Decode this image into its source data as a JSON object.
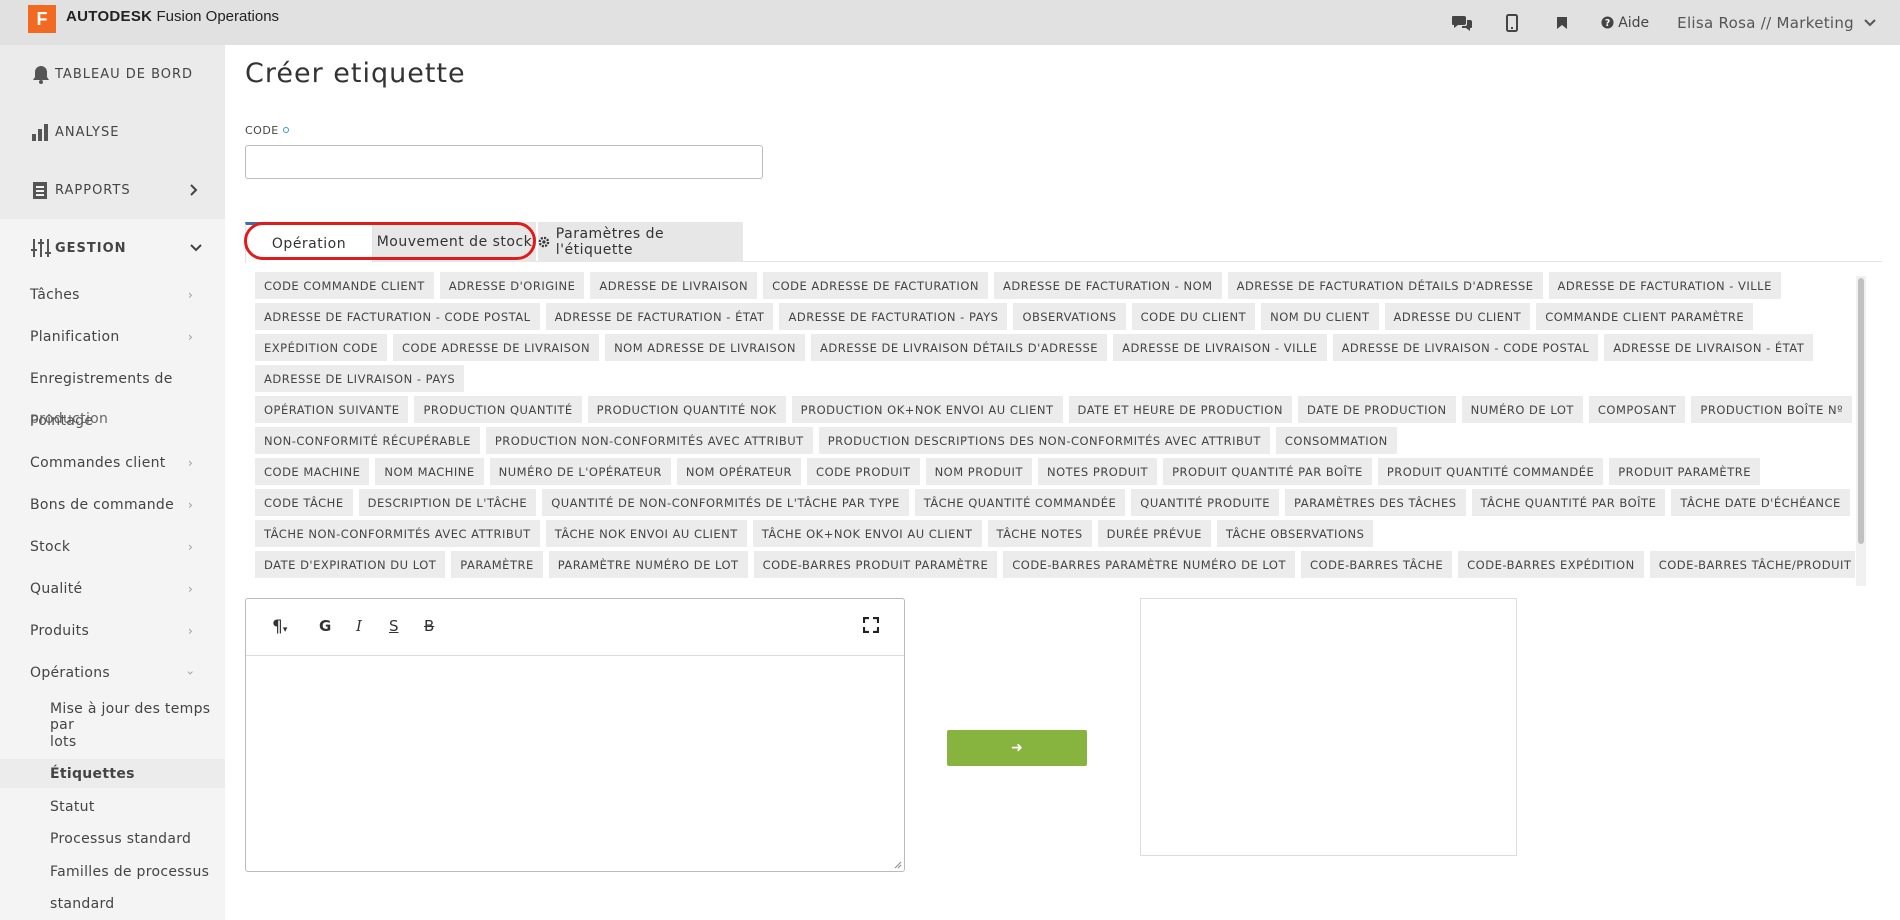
{
  "header": {
    "logo_letter": "F",
    "brand_bold": "AUTODESK",
    "brand_rest": "Fusion Operations",
    "help_label": "Aide",
    "user_label": "Elisa Rosa // Marketing"
  },
  "sidebar": {
    "main": [
      {
        "label": "TABLEAU DE BORD"
      },
      {
        "label": "ANALYSE"
      },
      {
        "label": "RAPPORTS"
      },
      {
        "label": "GESTION"
      }
    ],
    "items": [
      {
        "label": "Tâches"
      },
      {
        "label": "Planification"
      },
      {
        "label": "Enregistrements de"
      },
      {
        "label": "Commandes client"
      },
      {
        "label": "Bons de commande"
      },
      {
        "label": "Stock"
      },
      {
        "label": "Qualité"
      },
      {
        "label": "Produits"
      },
      {
        "label": "Opérations"
      }
    ],
    "overlap_line_a": "production",
    "overlap_line_b": "Pointage",
    "sub": [
      {
        "label": "Mise à jour des temps par"
      },
      {
        "label": "lots"
      },
      {
        "label": "Étiquettes"
      },
      {
        "label": "Statut"
      },
      {
        "label": "Processus standard"
      },
      {
        "label": "Familles de processus"
      },
      {
        "label": "standard"
      }
    ]
  },
  "main": {
    "title": "Créer etiquette",
    "code_label": "CODE",
    "code_value": "",
    "tabs": {
      "operation": "Opération",
      "stock": "Mouvement de stock",
      "params": "Paramètres de l'étiquette"
    },
    "tag_rows": [
      [
        "CODE COMMANDE CLIENT",
        "ADRESSE D'ORIGINE",
        "ADRESSE DE LIVRAISON",
        "CODE ADRESSE DE FACTURATION",
        "ADRESSE DE FACTURATION - NOM",
        "ADRESSE DE FACTURATION DÉTAILS D'ADRESSE",
        "ADRESSE DE FACTURATION - VILLE"
      ],
      [
        "ADRESSE DE FACTURATION - CODE POSTAL",
        "ADRESSE DE FACTURATION - ÉTAT",
        "ADRESSE DE FACTURATION - PAYS",
        "OBSERVATIONS",
        "CODE DU CLIENT",
        "NOM DU CLIENT",
        "ADRESSE DU CLIENT",
        "COMMANDE CLIENT PARAMÈTRE"
      ],
      [
        "EXPÉDITION CODE",
        "CODE ADRESSE DE LIVRAISON",
        "NOM ADRESSE DE LIVRAISON",
        "ADRESSE DE LIVRAISON DÉTAILS D'ADRESSE",
        "ADRESSE DE LIVRAISON - VILLE",
        "ADRESSE DE LIVRAISON - CODE POSTAL",
        "ADRESSE DE LIVRAISON - ÉTAT"
      ],
      [
        "ADRESSE DE LIVRAISON - PAYS"
      ],
      [
        "OPÉRATION SUIVANTE",
        "PRODUCTION QUANTITÉ",
        "PRODUCTION QUANTITÉ NOK",
        "PRODUCTION OK+NOK ENVOI AU CLIENT",
        "DATE ET HEURE DE PRODUCTION",
        "DATE DE PRODUCTION",
        "NUMÉRO DE LOT",
        "COMPOSANT",
        "PRODUCTION BOÎTE Nº"
      ],
      [
        "NON-CONFORMITÉ RÉCUPÉRABLE",
        "PRODUCTION NON-CONFORMITÉS AVEC ATTRIBUT",
        "PRODUCTION DESCRIPTIONS DES NON-CONFORMITÉS AVEC ATTRIBUT",
        "CONSOMMATION"
      ],
      [
        "CODE MACHINE",
        "NOM MACHINE",
        "NUMÉRO DE L'OPÉRATEUR",
        "NOM OPÉRATEUR",
        "CODE PRODUIT",
        "NOM PRODUIT",
        "NOTES PRODUIT",
        "PRODUIT QUANTITÉ PAR BOÎTE",
        "PRODUIT QUANTITÉ COMMANDÉE",
        "PRODUIT PARAMÈTRE"
      ],
      [
        "CODE TÂCHE",
        "DESCRIPTION DE L'TÂCHE",
        "QUANTITÉ DE NON-CONFORMITÉS DE L'TÂCHE PAR TYPE",
        "TÂCHE QUANTITÉ COMMANDÉE",
        "QUANTITÉ PRODUITE",
        "PARAMÈTRES DES TÂCHES",
        "TÂCHE QUANTITÉ PAR BOÎTE",
        "TÂCHE DATE D'ÉCHÉANCE"
      ],
      [
        "TÂCHE NON-CONFORMITÉS AVEC ATTRIBUT",
        "TÂCHE NOK ENVOI AU CLIENT",
        "TÂCHE OK+NOK ENVOI AU CLIENT",
        "TÂCHE NOTES",
        "DURÉE PRÉVUE",
        "TÂCHE OBSERVATIONS"
      ],
      [
        "DATE D'EXPIRATION DU LOT",
        "PARAMÈTRE",
        "PARAMÈTRE NUMÉRO DE LOT",
        "CODE-BARRES PRODUIT PARAMÈTRE",
        "CODE-BARRES PARAMÈTRE NUMÉRO DE LOT",
        "CODE-BARRES TÂCHE",
        "CODE-BARRES EXPÉDITION",
        "CODE-BARRES TÂCHE/PRODUIT"
      ]
    ],
    "editor": {
      "btn_paragraph": "¶",
      "btn_bold": "G",
      "btn_italic": "I",
      "btn_strike": "S",
      "btn_strike2": "B",
      "content": ""
    },
    "go_button": "➜"
  }
}
